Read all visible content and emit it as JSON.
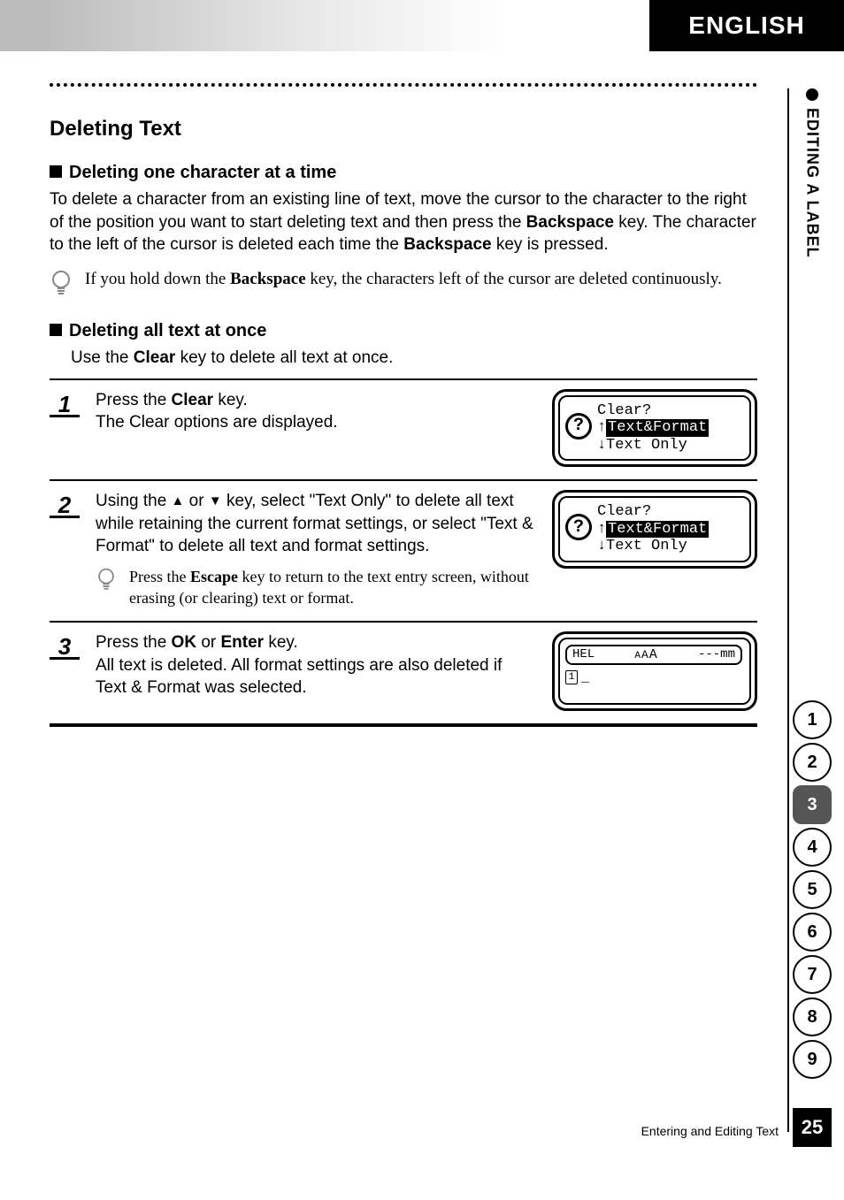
{
  "header": {
    "language": "ENGLISH"
  },
  "side": {
    "section": "EDITING A LABEL"
  },
  "tabs": [
    "1",
    "2",
    "3",
    "4",
    "5",
    "6",
    "7",
    "8",
    "9"
  ],
  "active_tab": "3",
  "page_number": "25",
  "footer": "Entering and Editing Text",
  "section": {
    "title": "Deleting Text",
    "sub1": {
      "heading": "Deleting one character at a time",
      "p_a": "To delete a character from an existing line of text, move the cursor to the character to the right of the position you want to start deleting text and then press the ",
      "p_b": "Backspace",
      "p_c": " key. The character to the left of the cursor is deleted each time the ",
      "p_d": "Backspace",
      "p_e": " key is pressed.",
      "note_a": "If you hold down the ",
      "note_b": "Backspace",
      "note_c": " key, the characters left of the cursor are deleted continuously."
    },
    "sub2": {
      "heading": "Deleting all text at once",
      "intro_a": "Use the ",
      "intro_b": "Clear",
      "intro_c": " key to delete all text at once."
    },
    "steps": {
      "s1": {
        "num": "1",
        "a": "Press the ",
        "b": "Clear",
        "c": " key.",
        "d": "The Clear options are displayed.",
        "screen": {
          "title": "Clear?",
          "opt1": "Text&Format",
          "opt2": "Text Only"
        }
      },
      "s2": {
        "num": "2",
        "a": "Using the ",
        "b": " or ",
        "c": " key, select \"Text Only\" to delete all text while retaining the current format settings, or select \"Text & Format\" to delete all text and format settings.",
        "note_a": "Press the ",
        "note_b": "Escape",
        "note_c": " key to return to the text entry screen, without erasing (or clearing) text or format.",
        "screen": {
          "title": "Clear?",
          "opt1": "Text&Format",
          "opt2": "Text Only"
        }
      },
      "s3": {
        "num": "3",
        "a": "Press the ",
        "b": "OK",
        "c": " or ",
        "d": "Enter",
        "e": " key.",
        "f": "All text is deleted. All format settings are also deleted if Text & Format was selected.",
        "screen": {
          "top_left": "HEL",
          "top_mid": "AAA",
          "top_right": "---mm",
          "line_no": "1",
          "cursor": "_"
        }
      }
    }
  }
}
